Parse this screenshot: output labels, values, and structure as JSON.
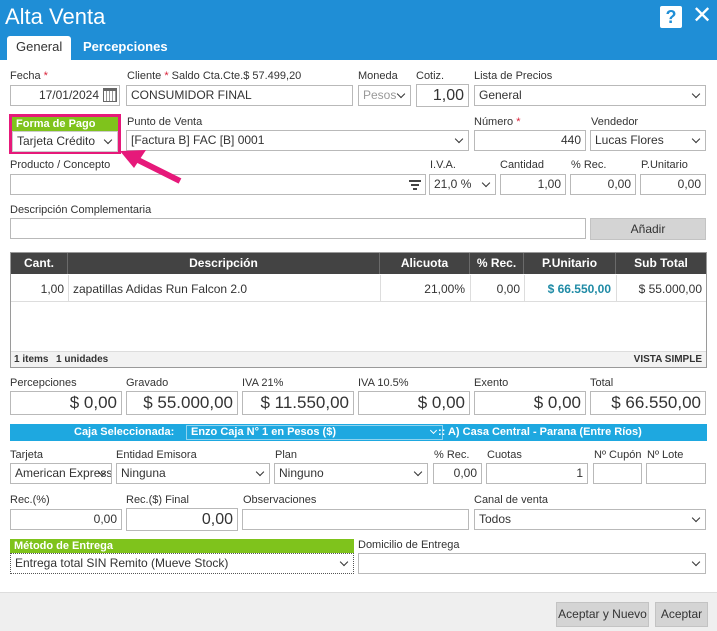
{
  "window": {
    "title": "Alta Venta"
  },
  "tabs": [
    {
      "label": "General"
    },
    {
      "label": "Percepciones"
    }
  ],
  "form": {
    "fecha": {
      "label": "Fecha",
      "value": "17/01/2024"
    },
    "cliente": {
      "label": "Cliente",
      "saldo": "Saldo Cta.Cte.$ 57.499,20",
      "value": "CONSUMIDOR FINAL"
    },
    "moneda": {
      "label": "Moneda",
      "value": "Pesos"
    },
    "cotiz": {
      "label": "Cotiz.",
      "value": "1,00"
    },
    "lista_precios": {
      "label": "Lista de Precios",
      "value": "General"
    },
    "forma_pago": {
      "label": "Forma de Pago",
      "value": "Tarjeta Crédito"
    },
    "punto_venta": {
      "label": "Punto de Venta",
      "value": "[Factura B] FAC [B] 0001"
    },
    "numero": {
      "label": "Número",
      "value": "440"
    },
    "vendedor": {
      "label": "Vendedor",
      "value": "Lucas Flores"
    },
    "producto": {
      "label": "Producto / Concepto",
      "value": ""
    },
    "iva": {
      "label": "I.V.A.",
      "value": "21,0 %"
    },
    "cantidad": {
      "label": "Cantidad",
      "value": "1,00"
    },
    "rec": {
      "label": "% Rec.",
      "value": "0,00"
    },
    "punitario": {
      "label": "P.Unitario",
      "value": "0,00"
    },
    "desc_comp": {
      "label": "Descripción Complementaria",
      "value": ""
    },
    "add_label": "Añadir"
  },
  "table": {
    "headers": [
      "Cant.",
      "Descripción",
      "Alicuota",
      "% Rec.",
      "P.Unitario",
      "Sub Total"
    ],
    "rows": [
      {
        "cant": "1,00",
        "desc": "zapatillas Adidas Run Falcon 2.0",
        "alicuota": "21,00%",
        "rec": "0,00",
        "punitario": "$ 66.550,00",
        "subtotal": "$ 55.000,00"
      }
    ],
    "footer_items": "1 items",
    "footer_units": "1 unidades",
    "view_mode": "VISTA SIMPLE"
  },
  "totals": {
    "percepciones": {
      "label": "Percepciones",
      "value": "$ 0,00"
    },
    "gravado": {
      "label": "Gravado",
      "value": "$ 55.000,00"
    },
    "iva21": {
      "label": "IVA 21%",
      "value": "$ 11.550,00"
    },
    "iva105": {
      "label": "IVA 10.5%",
      "value": "$ 0,00"
    },
    "exento": {
      "label": "Exento",
      "value": "$ 0,00"
    },
    "total": {
      "label": "Total",
      "value": "$ 66.550,00"
    }
  },
  "caja": {
    "label": "Caja Seleccionada:",
    "value": "Enzo Caja N° 1 en Pesos ($)",
    "branch": ":: A) Casa Central - Parana (Entre Ríos)"
  },
  "payment": {
    "tarjeta": {
      "label": "Tarjeta",
      "value": "American Express"
    },
    "entidad": {
      "label": "Entidad Emisora",
      "value": "Ninguna"
    },
    "plan": {
      "label": "Plan",
      "value": "Ninguno"
    },
    "rec": {
      "label": "% Rec.",
      "value": "0,00"
    },
    "cuotas": {
      "label": "Cuotas",
      "value": "1"
    },
    "cupon": {
      "label": "Nº Cupón",
      "value": ""
    },
    "lote": {
      "label": "Nº Lote",
      "value": ""
    },
    "rec_pct": {
      "label": "Rec.(%)",
      "value": "0,00"
    },
    "rec_final": {
      "label": "Rec.($) Final",
      "value": "0,00"
    },
    "observaciones": {
      "label": "Observaciones",
      "value": ""
    },
    "canal": {
      "label": "Canal de venta",
      "value": "Todos"
    }
  },
  "entrega": {
    "metodo": {
      "label": "Método de Entrega",
      "value": "Entrega total SIN Remito (Mueve Stock)"
    },
    "domicilio": {
      "label": "Domicilio de Entrega",
      "value": ""
    }
  },
  "footer": {
    "accept_new": "Aceptar y Nuevo",
    "accept": "Aceptar"
  },
  "colors": {
    "header": "#1f8ed6",
    "highlight": "#e6197a",
    "green": "#7fc31c"
  }
}
